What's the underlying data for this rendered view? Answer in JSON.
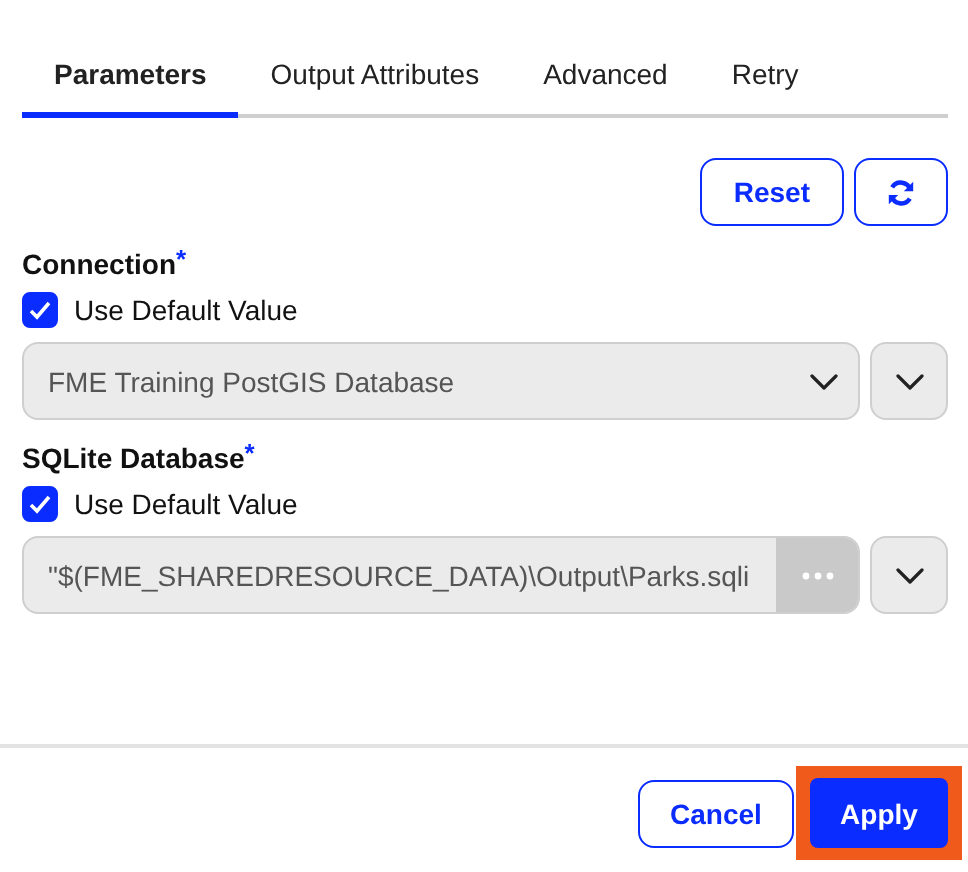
{
  "tabs": [
    {
      "label": "Parameters",
      "selected": true
    },
    {
      "label": "Output Attributes",
      "selected": false
    },
    {
      "label": "Advanced",
      "selected": false
    },
    {
      "label": "Retry",
      "selected": false
    }
  ],
  "toolbar": {
    "reset": "Reset"
  },
  "parameters": [
    {
      "kind": "select",
      "label": "Connection",
      "required_mark": "*",
      "use_default": {
        "label": "Use Default Value",
        "checked": true
      },
      "dropdown": {
        "value": "FME Training PostGIS Database"
      }
    },
    {
      "kind": "file",
      "label": "SQLite Database",
      "required_mark": "*",
      "use_default": {
        "label": "Use Default Value",
        "checked": true
      },
      "path_field": {
        "value": "\"$(FME_SHAREDRESOURCE_DATA)\\Output\\Parks.sqli"
      }
    }
  ],
  "footer": {
    "cancel": "Cancel",
    "apply": {
      "label": "Apply",
      "highlighted": true
    }
  }
}
